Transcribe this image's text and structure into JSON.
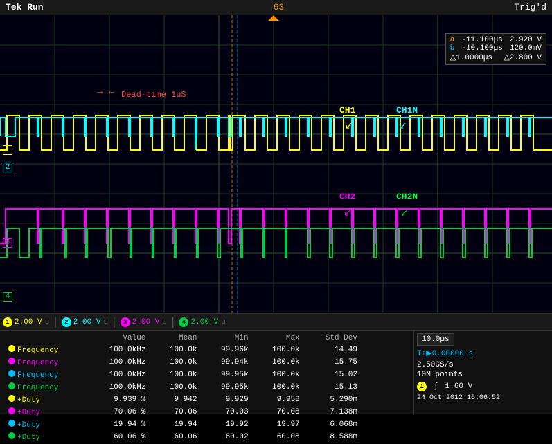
{
  "app": {
    "title": "Tek Run",
    "status": "Trig'd",
    "cursor_marker": "63"
  },
  "cursor": {
    "a_time": "-11.100µs",
    "a_volt": "2.920 V",
    "b_time": "-10.100µs",
    "b_volt": "120.0mV",
    "delta_time": "△1.0000µs",
    "delta_volt": "△2.800 V"
  },
  "channels": {
    "ch1": {
      "label": "CH1",
      "color": "#ffff00",
      "volt": "2.00 V",
      "num": "1"
    },
    "ch1n": {
      "label": "CH1N",
      "color": "#00ffff",
      "volt": "2.00 V",
      "num": "2"
    },
    "ch2": {
      "label": "CH2",
      "color": "#ff00ff",
      "volt": "2.00 V",
      "num": "3"
    },
    "ch2n": {
      "label": "CH2N",
      "color": "#00ff44",
      "volt": "2.00 V",
      "num": "4"
    }
  },
  "annotations": {
    "dead_time": "Dead-time 1uS"
  },
  "measurements": {
    "headers": [
      "",
      "Value",
      "Mean",
      "Min",
      "Max",
      "Std Dev"
    ],
    "rows": [
      {
        "ch": "1",
        "param": "Frequency",
        "value": "100.0kHz",
        "mean": "100.0k",
        "min": "99.96k",
        "max": "100.0k",
        "stddev": "14.49"
      },
      {
        "ch": "2",
        "param": "Frequency",
        "value": "100.0kHz",
        "mean": "100.0k",
        "min": "99.94k",
        "max": "100.0k",
        "stddev": "15.75"
      },
      {
        "ch": "3",
        "param": "Frequency",
        "value": "100.0kHz",
        "mean": "100.0k",
        "min": "99.95k",
        "max": "100.0k",
        "stddev": "15.02"
      },
      {
        "ch": "4",
        "param": "Frequency",
        "value": "100.0kHz",
        "mean": "100.0k",
        "min": "99.95k",
        "max": "100.0k",
        "stddev": "15.13"
      },
      {
        "ch": "1",
        "param": "+Duty",
        "value": "9.939 %",
        "mean": "9.942",
        "min": "9.929",
        "max": "9.958",
        "stddev": "5.290m"
      },
      {
        "ch": "2",
        "param": "+Duty",
        "value": "70.06 %",
        "mean": "70.06",
        "min": "70.03",
        "max": "70.08",
        "stddev": "7.138m"
      },
      {
        "ch": "3",
        "param": "+Duty",
        "value": "19.94 %",
        "mean": "19.94",
        "min": "19.92",
        "max": "19.97",
        "stddev": "6.068m"
      },
      {
        "ch": "4",
        "param": "+Duty",
        "value": "60.06 %",
        "mean": "60.06",
        "min": "60.02",
        "max": "60.08",
        "stddev": "8.588m"
      }
    ]
  },
  "timebase": {
    "per_div": "10.0µs",
    "position": "T+▶0.00000 s"
  },
  "sample": {
    "rate": "2.50GS/s",
    "points": "10M points"
  },
  "trigger": {
    "channel": "1",
    "level": "1.60 V",
    "symbol": "∫"
  },
  "datetime": "24 Oct 2012  16:06:52",
  "ch_settings": [
    {
      "num": "1",
      "color": "#ffff00",
      "volt": "2.00 V",
      "coupling": "u"
    },
    {
      "num": "2",
      "color": "#00ffff",
      "volt": "2.00 V",
      "coupling": "u"
    },
    {
      "num": "3",
      "color": "#ff00ff",
      "volt": "2.00 V",
      "coupling": "u"
    },
    {
      "num": "4",
      "color": "#00ff44",
      "volt": "2.00 V",
      "coupling": "u"
    }
  ]
}
